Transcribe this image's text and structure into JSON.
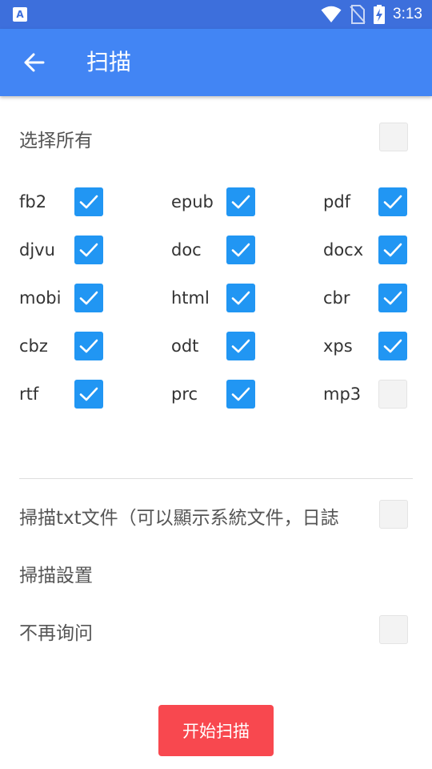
{
  "status_bar": {
    "time": "3:13",
    "app_icon": "A",
    "icons": [
      "wifi-icon",
      "no-sim-icon",
      "battery-charging-icon"
    ]
  },
  "toolbar": {
    "back_icon": "arrow-left-icon",
    "title": "扫描"
  },
  "select_all": {
    "label": "选择所有",
    "checked": false
  },
  "formats": [
    {
      "label": "fb2",
      "checked": true
    },
    {
      "label": "epub",
      "checked": true
    },
    {
      "label": "pdf",
      "checked": true
    },
    {
      "label": "djvu",
      "checked": true
    },
    {
      "label": "doc",
      "checked": true
    },
    {
      "label": "docx",
      "checked": true
    },
    {
      "label": "mobi",
      "checked": true
    },
    {
      "label": "html",
      "checked": true
    },
    {
      "label": "cbr",
      "checked": true
    },
    {
      "label": "cbz",
      "checked": true
    },
    {
      "label": "odt",
      "checked": true
    },
    {
      "label": "xps",
      "checked": true
    },
    {
      "label": "rtf",
      "checked": true
    },
    {
      "label": "prc",
      "checked": true
    },
    {
      "label": "mp3",
      "checked": false
    }
  ],
  "options": {
    "scan_txt": {
      "label": "掃描txt文件（可以顯示系統文件，日誌",
      "checked": false
    },
    "scan_settings": {
      "label": "掃描設置"
    },
    "dont_ask": {
      "label": "不再询问",
      "checked": false
    }
  },
  "start_button": {
    "label": "开始扫描"
  },
  "colors": {
    "status_bar": "#3d6fdc",
    "toolbar": "#4285f4",
    "checkbox_on": "#2196f3",
    "button": "#f8484f"
  }
}
